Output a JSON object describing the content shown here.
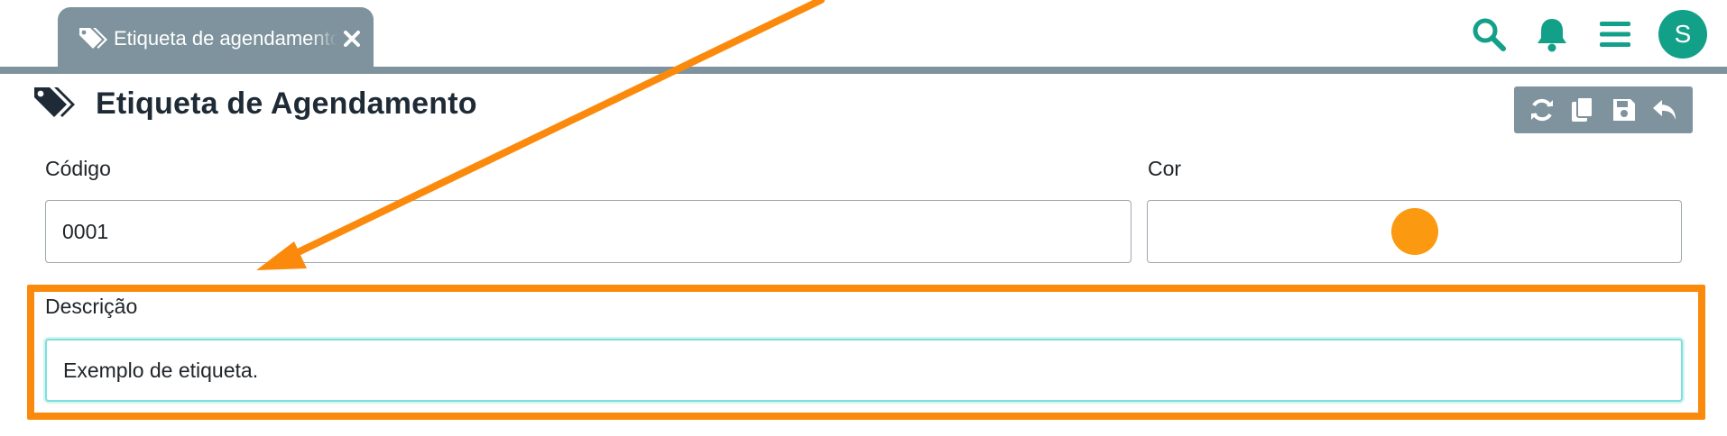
{
  "tab": {
    "label": "Etiqueta de agendamento",
    "icon": "tags-icon"
  },
  "header": {
    "title": "Etiqueta de Agendamento",
    "icon": "tags-icon",
    "avatar_initial": "S"
  },
  "top_icons": [
    "search-icon",
    "bell-icon",
    "menu-icon"
  ],
  "toolbar_icons": [
    "sync-icon",
    "copy-icon",
    "save-icon",
    "undo-icon"
  ],
  "form": {
    "codigo": {
      "label": "Código",
      "value": "0001"
    },
    "cor": {
      "label": "Cor",
      "value": "#fb9a10"
    },
    "descricao": {
      "label": "Descrição",
      "value": "Exemplo de etiqueta."
    }
  },
  "colors": {
    "accent": "#13a089",
    "tab_bg": "#7e939d",
    "annotation": "#fb8a0c",
    "focus": "#7fe0db"
  }
}
